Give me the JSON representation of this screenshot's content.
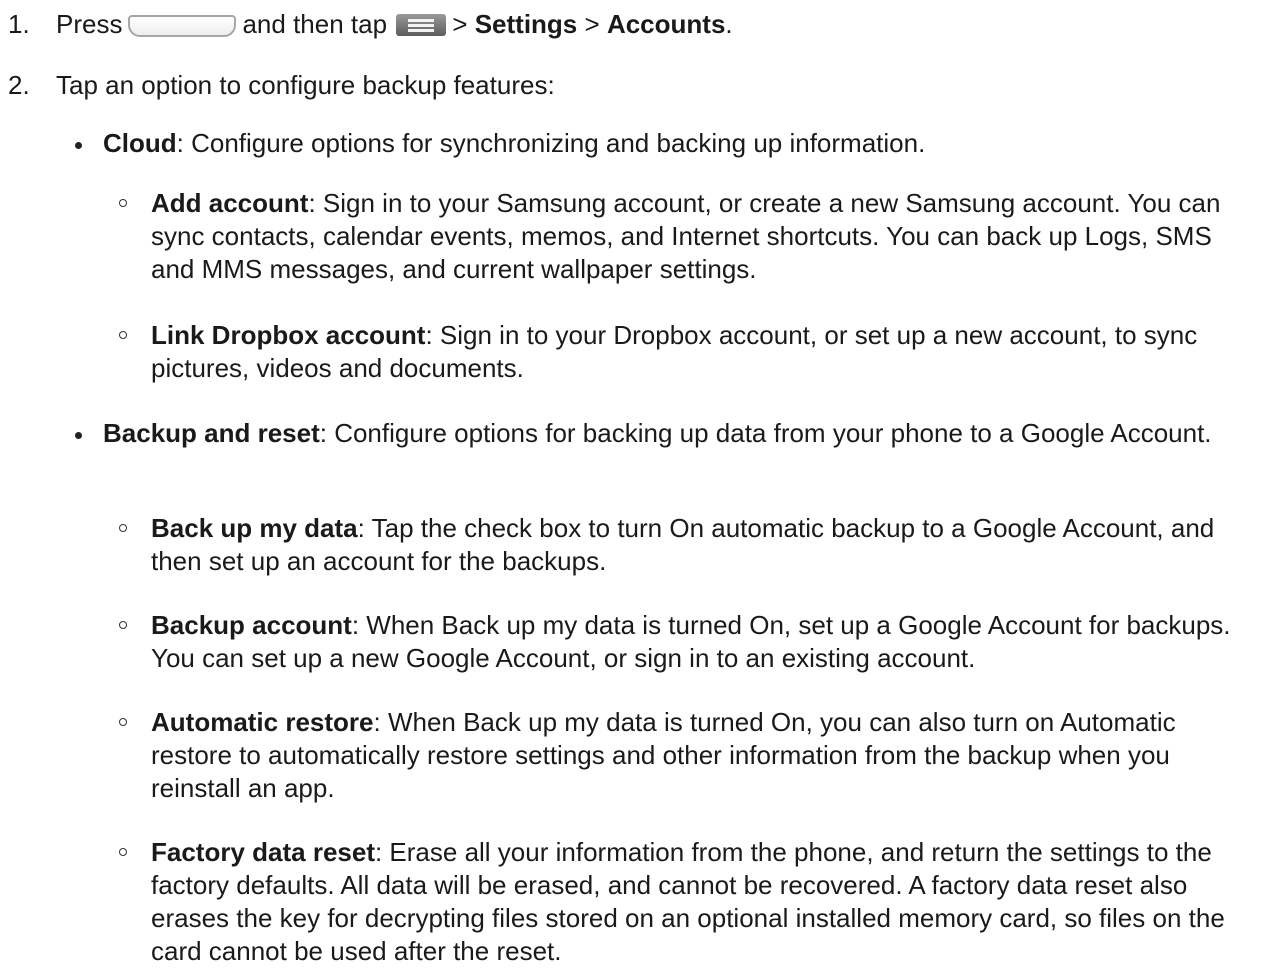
{
  "step1": {
    "number": "1.",
    "press": "Press",
    "and_then_tap": "and then tap",
    "separator": ">",
    "settings": "Settings",
    "accounts": "Accounts",
    "period": "."
  },
  "step2": {
    "number": "2.",
    "text": "Tap an option to configure backup features:"
  },
  "bullets": [
    {
      "title": "Cloud",
      "text": ": Configure options for synchronizing and backing up information.",
      "subitems": [
        {
          "title": "Add account",
          "text": ": Sign in to your Samsung account, or create a new Samsung account. You can sync contacts, calendar events, memos, and Internet shortcuts. You can back up Logs, SMS and MMS messages, and current wallpaper settings."
        },
        {
          "title": "Link Dropbox account",
          "text": ": Sign in to your Dropbox account, or set up a new account, to sync pictures, videos and documents."
        }
      ]
    },
    {
      "title": "Backup and reset",
      "text": ": Configure options for backing up data from your phone to a Google Account.",
      "subitems": [
        {
          "title": "Back up my data",
          "text": ": Tap the check box to turn On automatic backup to a Google Account, and then set up an account for the backups."
        },
        {
          "title": "Backup account",
          "text": ": When Back up my data is turned On, set up a Google Account for backups. You can set up a new Google Account, or sign in to an existing account."
        },
        {
          "title": "Automatic restore",
          "text": ": When Back up my data is turned On, you can also turn on Automatic restore to automatically restore settings and other information from the backup when you reinstall an app."
        },
        {
          "title": "Factory data reset",
          "text": ": Erase all your information from the phone, and return the settings to the factory defaults. All data will be erased, and cannot be recovered. A factory data reset also erases the key for decrypting files stored on an optional installed memory card, so files on the card cannot be used after the reset."
        }
      ]
    }
  ],
  "icons": {
    "home_key": "home-key-icon",
    "menu_key": "menu-key-icon"
  }
}
